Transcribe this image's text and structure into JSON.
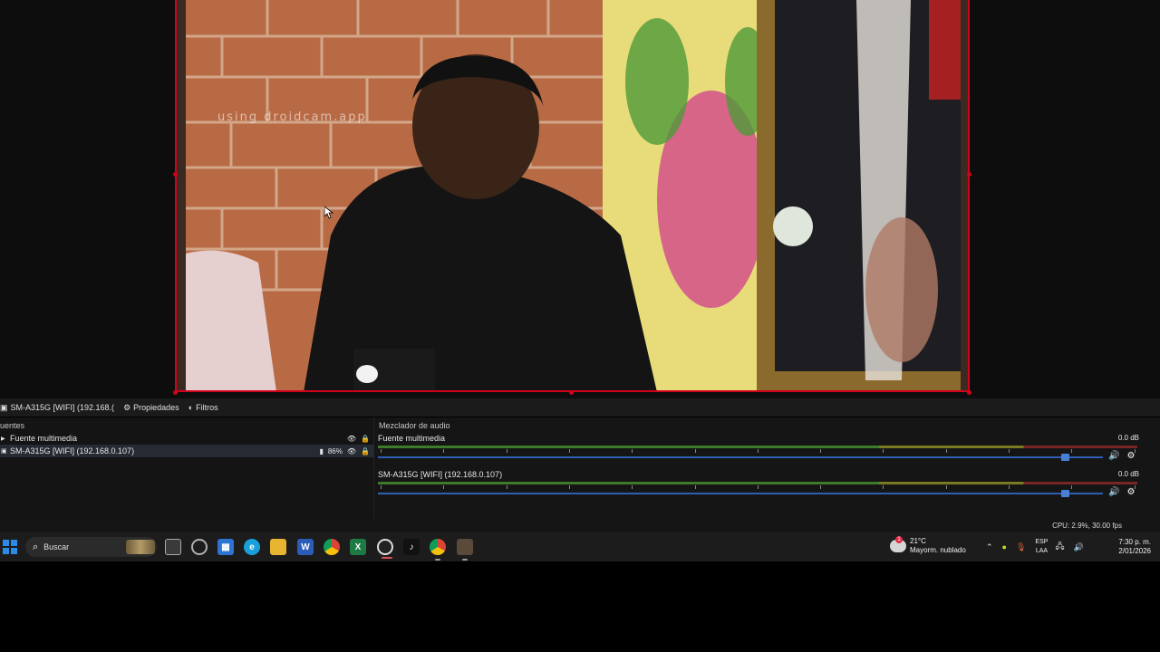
{
  "preview": {
    "watermark": "using droidcam.app"
  },
  "source_toolbar": {
    "source_name": "SM-A315G [WIFI] (192.168.(",
    "properties_label": "Propiedades",
    "filters_label": "Filtros"
  },
  "sources": {
    "title": "uentes",
    "items": [
      {
        "label": "Fuente multimedia",
        "percent": ""
      },
      {
        "label": "SM-A315G [WIFI] (192.168.0.107)",
        "percent": "86%"
      }
    ]
  },
  "mixer": {
    "title": "Mezclador de audio",
    "channels": [
      {
        "name": "Fuente multimedia",
        "db": "0.0 dB",
        "volume_fraction": 0.95
      },
      {
        "name": "SM-A315G [WIFI] (192.168.0.107)",
        "db": "0.0 dB",
        "volume_fraction": 0.95
      }
    ]
  },
  "status": {
    "text": "CPU: 2.9%, 30.00 fps"
  },
  "taskbar": {
    "search_placeholder": "Buscar",
    "weather_temp": "21°C",
    "weather_desc": "Mayorm. nublado",
    "weather_badge": "1",
    "lang_top": "ESP",
    "lang_bottom": "LAA",
    "time": "7:30 p. m.",
    "date": "2/01/2026",
    "apps": [
      "task-view-icon",
      "copilot-icon",
      "store-icon",
      "edge-icon",
      "file-explorer-icon",
      "word-icon",
      "chrome-icon",
      "excel-icon",
      "obs-icon",
      "tiktok-icon",
      "chrome-profile-icon",
      "app-icon"
    ]
  },
  "colors": {
    "selection_border": "#d0021b",
    "accent": "#2b8be8",
    "slider": "#2f5fb4"
  }
}
